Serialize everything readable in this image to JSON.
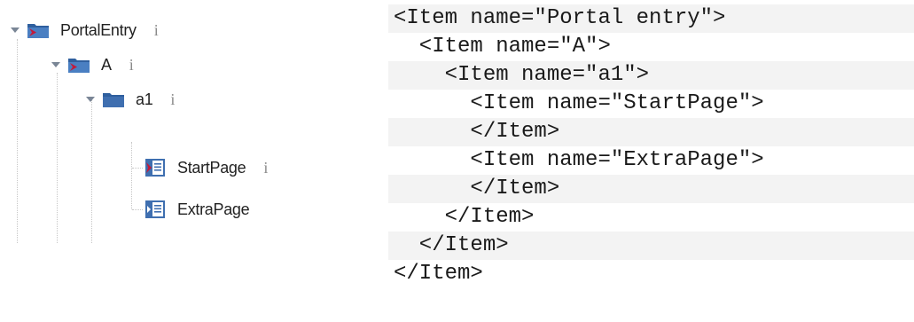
{
  "tree": {
    "nodes": [
      {
        "label": "PortalEntry",
        "info": "i"
      },
      {
        "label": "A",
        "info": "i"
      },
      {
        "label": "a1",
        "info": "i"
      },
      {
        "label": "StartPage",
        "info": "i"
      },
      {
        "label": "ExtraPage"
      }
    ],
    "icons": {
      "portal_entry": "portal-folder-icon",
      "folder_a": "portal-folder-icon",
      "folder_a1": "folder-icon",
      "start_page": "page-icon",
      "extra_page": "page-icon"
    }
  },
  "code": {
    "lines": [
      "<Item name=\"Portal entry\">",
      "  <Item name=\"A\">",
      "    <Item name=\"a1\">",
      "      <Item name=\"StartPage\">",
      "      </Item>",
      "      <Item name=\"ExtraPage\">",
      "      </Item>",
      "    </Item>",
      "  </Item>",
      "</Item>"
    ]
  },
  "colors": {
    "folder_blue": "#2f5f9e",
    "portal_red": "#c21a3b",
    "code_shade": "#f3f3f3",
    "info_gray": "#8a8a8a"
  }
}
